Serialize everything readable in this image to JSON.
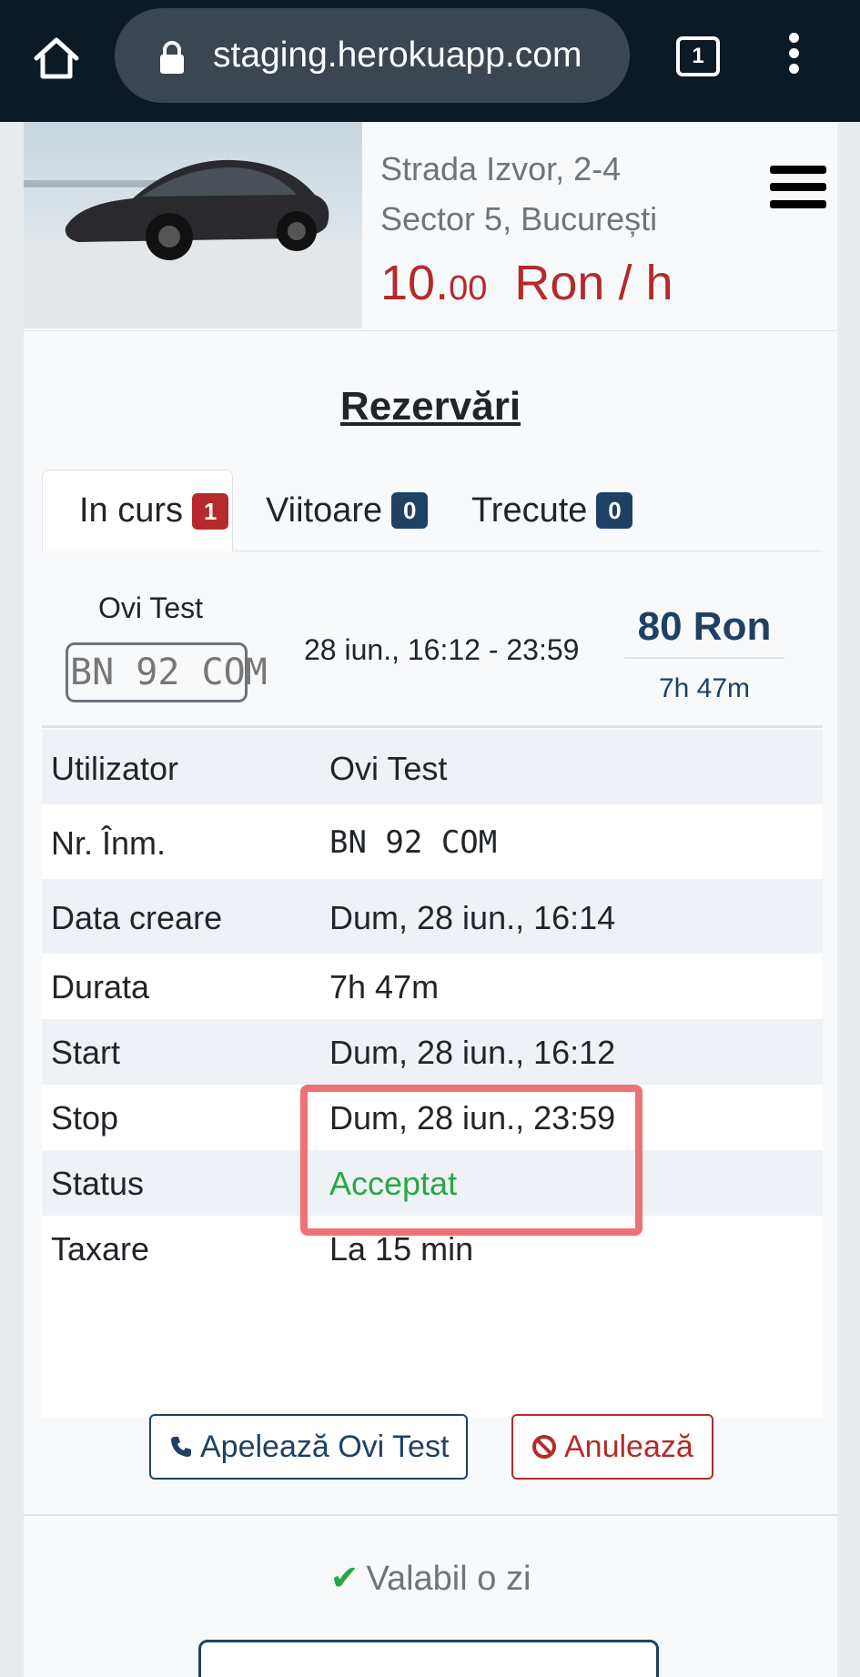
{
  "browser": {
    "url": "staging.herokuapp.com",
    "tab_count": "1"
  },
  "parking": {
    "address_line1": "Strada Izvor, 2-4",
    "address_line2": "Sector 5, București",
    "price_int": "10.",
    "price_cents": "00",
    "price_unit": "Ron / h"
  },
  "reservations": {
    "title": "Rezervări",
    "tabs": [
      {
        "label": "In curs",
        "count": "1"
      },
      {
        "label": "Viitoare",
        "count": "0"
      },
      {
        "label": "Trecute",
        "count": "0"
      }
    ],
    "summary": {
      "name": "Ovi Test",
      "plate": "BN 92 COM",
      "time_range": "28 iun., 16:12 - 23:59",
      "price": "80 Ron",
      "duration": "7h 47m"
    },
    "details": [
      {
        "key": "Utilizator",
        "value": "Ovi Test"
      },
      {
        "key": "Nr. Înm.",
        "value": "BN 92 COM"
      },
      {
        "key": "Data creare",
        "value": "Dum, 28 iun., 16:14"
      },
      {
        "key": "Durata",
        "value": "7h 47m"
      },
      {
        "key": "Start",
        "value": "Dum, 28 iun., 16:12"
      },
      {
        "key": "Stop",
        "value": "Dum, 28 iun., 23:59"
      },
      {
        "key": "Status",
        "value": "Acceptat"
      },
      {
        "key": "Taxare",
        "value": "La 15 min"
      }
    ],
    "call_button": "Apelează Ovi Test",
    "cancel_button": "Anulează"
  },
  "validity": "Valabil o zi",
  "colors": {
    "brand_blue": "#1e4163",
    "danger_red": "#b52a2a",
    "success_green": "#28a745",
    "highlight": "#ef7178"
  }
}
